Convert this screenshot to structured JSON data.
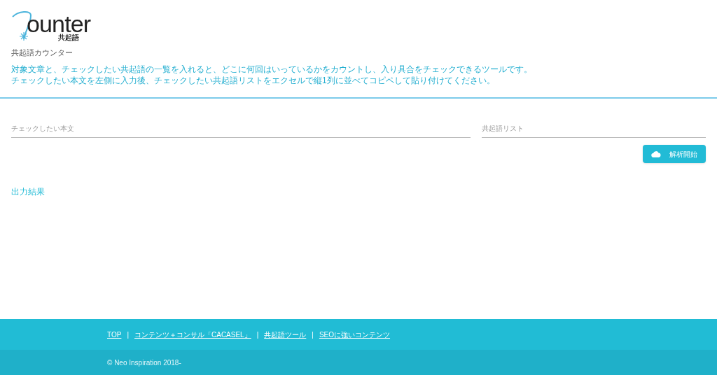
{
  "logo": {
    "word": "ounter",
    "sub": "共起語"
  },
  "site_name": "共起語カウンター",
  "description": [
    "対象文章と、チェックしたい共起語の一覧を入れると、どこに何回はいっているかをカウントし、入り具合をチェックできるツールです。",
    "チェックしたい本文を左側に入力後、チェックしたい共起語リストをエクセルで縦1列に並べてコピペして貼り付けてください。"
  ],
  "fields": [
    {
      "placeholder": "チェックしたい本文"
    },
    {
      "placeholder": "共起語リスト"
    }
  ],
  "analyze_button": "解析開始",
  "output_title": "出力結果",
  "footer": {
    "links": [
      "TOP",
      "コンテンツ＋コンサル「CACASEL」",
      "共起語ツール",
      "SEOに強いコンテンツ"
    ],
    "separator": "|",
    "copyright": "© Neo Inspiration 2018-"
  }
}
